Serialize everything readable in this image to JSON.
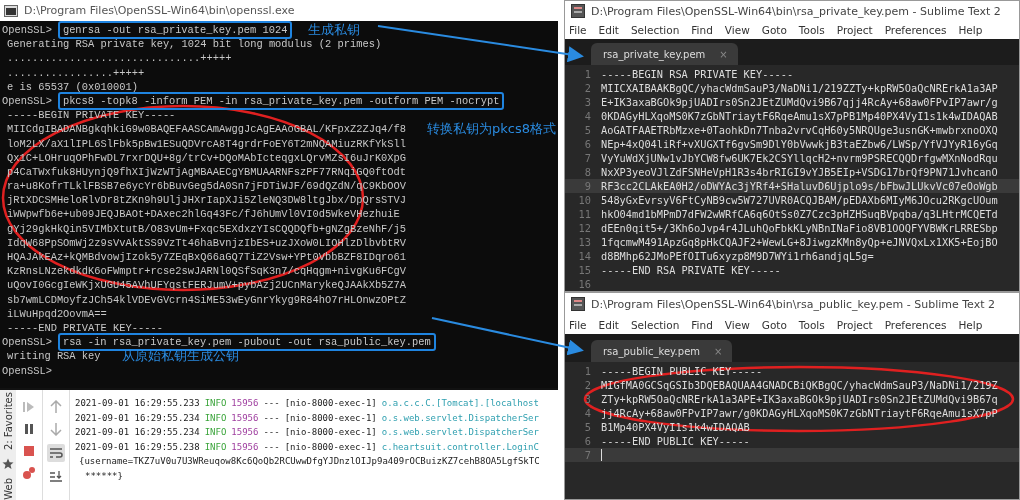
{
  "terminal": {
    "title": "D:\\Program Files\\OpenSSL-Win64\\bin\\openssl.exe",
    "lines": [
      {
        "prompt": "OpenSSL>",
        "text": "genrsa -out rsa_private_key.pem 1024",
        "boxed": true,
        "note": "生成私钥"
      },
      {
        "text": "Generating RSA private key, 1024 bit long modulus (2 primes)",
        "boxed": false
      },
      {
        "text": "...............................+++++",
        "boxed": false
      },
      {
        "text": ".................+++++",
        "boxed": false
      },
      {
        "text": "e is 65537 (0x010001)",
        "boxed": false
      },
      {
        "prompt": "OpenSSL>",
        "text": "pkcs8 -topk8 -inform PEM -in rsa_private_key.pem -outform PEM -nocrypt",
        "boxed": true
      },
      {
        "text": "-----BEGIN PRIVATE KEY-----",
        "boxed": false
      },
      {
        "text": "MIICdgIBADANBgkqhkiG9w0BAQEFAASCAmAwggJcAgEAAoGBAL/KFpxZ2ZJq4/f8",
        "boxed": false,
        "note": "转换私钥为pkcs8格式"
      },
      {
        "text": "loM2LX/aX1lIPL6SlFbk5pBw1ESuQDVrcA8T4grdrFoEY6T2mNQAMiuzRKfYkSll",
        "boxed": false
      },
      {
        "text": "Qx1C+LOHruqOPhFwDL7rxrDQU+8g/trCv+DQoMAbIcteqgxLQrvMZsI6uJrK0XpG",
        "boxed": false
      },
      {
        "text": "p4CaTWxfuk8HUynjQ9fhXIjWzWTjAgMBAAECgYBMUAARNFszPF77RNqiGQ0ftOdt",
        "boxed": false
      },
      {
        "text": "ra+u8KofrTLklFBSB7e6ycYr6bBuvGeg5dA0Sn7jFDTiWJF/69dQZdN/qC9KbOOV",
        "boxed": false
      },
      {
        "text": "jRtXDCSMHeloRlvDr8tZKn9h9UljJHXrIapXJi5ZleNQ3DW8ltgJbx/DpQrsSTVJ",
        "boxed": false
      },
      {
        "text": "iWWpwfb6e+ub09JEQJBAOt+DAxec2hlGq43Fc/fJ6hUmVl0VI0d5WkeVHezhuiE",
        "boxed": false
      },
      {
        "text": "gYj29gkHkQin5VIMbXtutB/O83vUm+Fxqc5EXdxzYIsCQQDQfb+gNZgBzeNhF/j5",
        "boxed": false
      },
      {
        "text": "IdqW68PpSOmWj2z9sVvAktSS9VzTt46haBvnjzIbES+uzJXoW0LIOHlzDlbvbtRV",
        "boxed": false
      },
      {
        "text": "HQAJAkEAz+kQMBdvowjIzok5y7ZEqBxQ66aGQ7TiZ2Vsw+YPt0VbbBZF8IDqro61",
        "boxed": false
      },
      {
        "text": "KzRnsLNzekdkdK6oFWmptr+rcse2swJARNl0QSfSqK3n7/cqHqgm+nivgKu6FCgV",
        "boxed": false
      },
      {
        "text": "uQovI0GcgIeWKjxUGU45AVhUFYqstFERJumV+pybAzj2UCnMarykeQJAAkXb5Z7A",
        "boxed": false
      },
      {
        "text": "sb7wmLCDMoyfzJCh54klVDEvGVcrn4SiME53wEyGnrYkyg9R84hO7rHLOnwzOPtZ",
        "boxed": false
      },
      {
        "text": "iLWuHpqd2OovmA==",
        "boxed": false
      },
      {
        "text": "-----END PRIVATE KEY-----",
        "boxed": false
      },
      {
        "prompt": "OpenSSL>",
        "text": "rsa -in rsa_private_key.pem -pubout -out rsa_public_key.pem",
        "boxed": true
      },
      {
        "text": "writing RSA key",
        "boxed": false,
        "note": "从原始私钥生成公钥"
      },
      {
        "prompt": "OpenSSL>"
      }
    ]
  },
  "editors": [
    {
      "title": "D:\\Program Files\\OpenSSL-Win64\\bin\\rsa_private_key.pem - Sublime Text 2",
      "menu": [
        "File",
        "Edit",
        "Selection",
        "Find",
        "View",
        "Goto",
        "Tools",
        "Project",
        "Preferences",
        "Help"
      ],
      "tab": "rsa_private_key.pem",
      "tab_close": "×",
      "lines": [
        {
          "number": "1",
          "text": "-----BEGIN RSA PRIVATE KEY-----",
          "current": false
        },
        {
          "number": "2",
          "text": "MIICXAIBAAKBgQC/yhacWdmSauP3/NaDNi1/219ZZTy+kpRW5OaQcNRErkA1a3AP",
          "current": false
        },
        {
          "number": "3",
          "text": "E+IK3axaBGOk9pjUADIrs0Sn2JEtZUMdQvi9B67qjj4RcAy+68aw0FPvIP7awr/g",
          "current": false
        },
        {
          "number": "4",
          "text": "0KDAGyHLXqoMS0K7zGbNTriaytF6RqeAmu1sX7pPB1Mp40PX4VyI1s1k4wIDAQAB",
          "current": false
        },
        {
          "number": "5",
          "text": "AoGATFAAETRbMzxe+0TaohkDn7Tnba2vrvCqH60y5NRQUge3usnGK+mwbrxnoOXQ",
          "current": false
        },
        {
          "number": "6",
          "text": "NEp+4xQ04liRf+vXUGXTf6gvSm9DlY0bVwwkjB3taEZbw6/LWSp/YfVJYyR16yGq",
          "current": false
        },
        {
          "number": "7",
          "text": "VyYuWdXjUNw1vJbYCW8fw6UK7Ek2CSYllqcH2+nvrm9PSRECQQDrfgwMXnNodRqu",
          "current": false
        },
        {
          "number": "8",
          "text": "NxXP3yeoVJlZdFSNHeVpH1R3s4brRIGI9vYJB5EIp+VSDG17brQf9PN71JvhcanO",
          "current": false
        },
        {
          "number": "9",
          "text": "RF3cc2CLAkEA0H2/oDWYAc3jYRf4+SHaluvD6Ujplo9s/bFbwJLUkvVc07eOoWgb",
          "current": true
        },
        {
          "number": "10",
          "text": "548yGxEvrsyV6FtCyNB9cw5W727UVR0ACQJBAM/pEDAXb6MIyM6JOcu2RKgcUOum",
          "current": false
        },
        {
          "number": "11",
          "text": "hkO04md1bMPmD7dFW2wWRfCA6q6OtSs0Z7Czc3pHZHSuqBVpqba/q3LHtrMCQETd",
          "current": false
        },
        {
          "number": "12",
          "text": "dEEn0qit5+/3Kh6oJvp4r4JLuhQoFbkKLyNBnINaFio8VB1OOQFYVBWKrLRRESbp",
          "current": false
        },
        {
          "number": "13",
          "text": "1fqcmwM491ApzGq8pHkCQAJF2+WewLG+8JiwgzKMn8yQp+eJNVQxLx1XK5+EojBO",
          "current": false
        },
        {
          "number": "14",
          "text": "d8BMhp62JMoPEfOITu6xyzp8M9D7WYi1rh6andjqL5g=",
          "current": false
        },
        {
          "number": "15",
          "text": "-----END RSA PRIVATE KEY-----",
          "current": false
        },
        {
          "number": "16",
          "current": false
        }
      ]
    },
    {
      "title": "D:\\Program Files\\OpenSSL-Win64\\bin\\rsa_public_key.pem - Sublime Text 2",
      "menu": [
        "File",
        "Edit",
        "Selection",
        "Find",
        "View",
        "Goto",
        "Tools",
        "Project",
        "Preferences",
        "Help"
      ],
      "tab": "rsa_public_key.pem",
      "tab_close": "×",
      "lines": [
        {
          "number": "1",
          "text": "-----BEGIN PUBLIC KEY-----",
          "current": false
        },
        {
          "number": "2",
          "text": "MIGfMA0GCSqGSIb3DQEBAQUAA4GNADCBiQKBgQC/yhacWdmSauP3/NaDNi1/219Z",
          "current": false
        },
        {
          "number": "3",
          "text": "ZTy+kpRW5OaQcNRErkA1a3APE+IK3axaBGOk9pjUADIrs0Sn2JEtZUMdQvi9B67q",
          "current": false
        },
        {
          "number": "4",
          "text": "jj4RcAy+68aw0FPvIP7awr/g0KDAGyHLXqoMS0K7zGbNTriaytF6RqeAmu1sX7pP",
          "current": false
        },
        {
          "number": "5",
          "text": "B1Mp40PX4VyI1s1k4wIDAQAB",
          "current": false
        },
        {
          "number": "6",
          "text": "-----END PUBLIC KEY-----",
          "current": false
        },
        {
          "number": "7",
          "current": true
        }
      ]
    }
  ],
  "console": {
    "side_tabs": [
      "2: Favorites",
      "Web"
    ],
    "entries": [
      {
        "time": "2021-09-01 16:29:55.233",
        "level": "INFO",
        "pid": "15956",
        "sep": "---",
        "thread": "[nio-8000-exec-1]",
        "logger": "o.a.c.c.C.[Tomcat].[localhost"
      },
      {
        "time": "2021-09-01 16:29:55.234",
        "level": "INFO",
        "pid": "15956",
        "sep": "---",
        "thread": "[nio-8000-exec-1]",
        "logger": "o.s.web.servlet.DispatcherSer"
      },
      {
        "time": "2021-09-01 16:29:55.234",
        "level": "INFO",
        "pid": "15956",
        "sep": "---",
        "thread": "[nio-8000-exec-1]",
        "logger": "o.s.web.servlet.DispatcherSer"
      },
      {
        "time": "2021-09-01 16:29:55.238",
        "level": "INFO",
        "pid": "15956",
        "sep": "---",
        "thread": "[nio-8000-exec-1]",
        "logger": "c.heartsuit.controller.LoginC"
      }
    ],
    "message": [
      "{username=TKZ7uV0u7U3WReuqow8Kc6QoQb2RCUwwDfgYJDnzlOIJp9a409rOCBuizKZ7cehB8OA5LgfSkTC",
      "******}"
    ]
  }
}
